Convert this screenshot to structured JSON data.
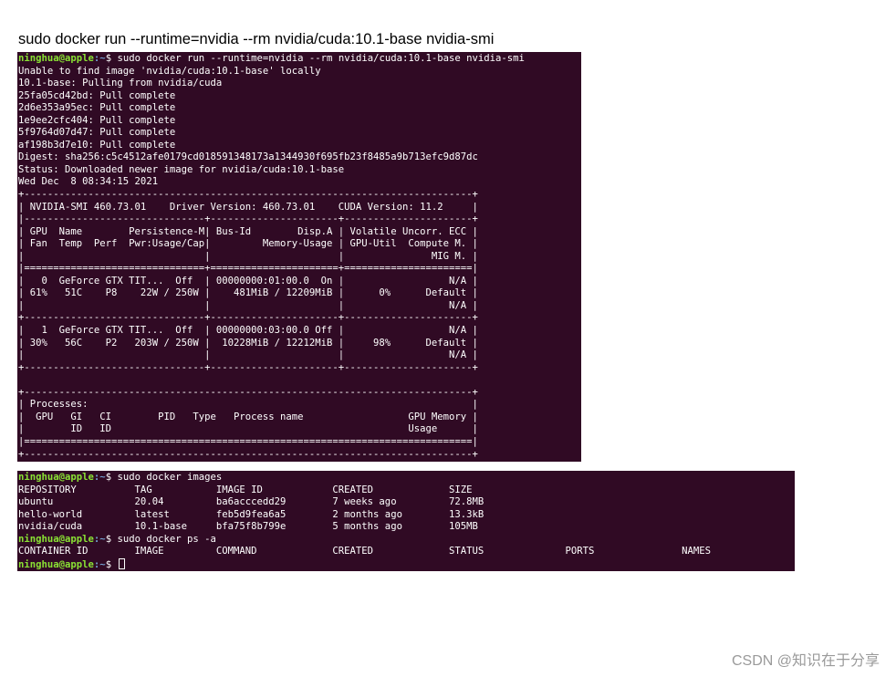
{
  "caption": "sudo docker run --runtime=nvidia --rm nvidia/cuda:10.1-base nvidia-smi",
  "prompt": {
    "user_host": "ninghua@apple",
    "path": ":~",
    "symbol": "$ "
  },
  "terminal1": {
    "command": "sudo docker run --runtime=nvidia --rm nvidia/cuda:10.1-base nvidia-smi",
    "lines": [
      "Unable to find image 'nvidia/cuda:10.1-base' locally",
      "10.1-base: Pulling from nvidia/cuda",
      "25fa05cd42bd: Pull complete",
      "2d6e353a95ec: Pull complete",
      "1e9ee2cfc404: Pull complete",
      "5f9764d07d47: Pull complete",
      "af198b3d7e10: Pull complete",
      "Digest: sha256:c5c4512afe0179cd01859134817 3a1344930f695fb23f8485a9b713efc9d87dc",
      "Status: Downloaded newer image for nvidia/cuda:10.1-base",
      "Wed Dec  8 08:34:15 2021",
      "+-----------------------------------------------------------------------------+",
      "| NVIDIA-SMI 460.73.01    Driver Version: 460.73.01    CUDA Version: 11.2     |",
      "|-------------------------------+----------------------+----------------------+",
      "| GPU  Name        Persistence-M| Bus-Id        Disp.A | Volatile Uncorr. ECC |",
      "| Fan  Temp  Perf  Pwr:Usage/Cap|         Memory-Usage | GPU-Util  Compute M. |",
      "|                               |                      |               MIG M. |",
      "|===============================+======================+======================|",
      "|   0  GeForce GTX TIT...  Off  | 00000000:01:00.0  On |                  N/A |",
      "| 61%   51C    P8    22W / 250W |    481MiB / 12209MiB |      0%      Default |",
      "|                               |                      |                  N/A |",
      "+-------------------------------+----------------------+----------------------+",
      "|   1  GeForce GTX TIT...  Off  | 00000000:03:00.0 Off |                  N/A |",
      "| 30%   56C    P2   203W / 250W |  10228MiB / 12212MiB |     98%      Default |",
      "|                               |                      |                  N/A |",
      "+-------------------------------+----------------------+----------------------+",
      "",
      "+-----------------------------------------------------------------------------+",
      "| Processes:                                                                  |",
      "|  GPU   GI   CI        PID   Type   Process name                  GPU Memory |",
      "|        ID   ID                                                   Usage      |",
      "|=============================================================================|",
      "+-----------------------------------------------------------------------------+"
    ]
  },
  "terminal2": {
    "images_command": "sudo docker images",
    "images_table": [
      "REPOSITORY          TAG           IMAGE ID            CREATED             SIZE",
      "ubuntu              20.04         ba6acccedd29        7 weeks ago         72.8MB",
      "hello-world         latest        feb5d9fea6a5        2 months ago        13.3kB",
      "nvidia/cuda         10.1-base     bfa75f8b799e        5 months ago        105MB"
    ],
    "ps_command": "sudo docker ps -a",
    "ps_header": "CONTAINER ID        IMAGE         COMMAND             CREATED             STATUS              PORTS               NAMES"
  },
  "watermark": "CSDN @知识在于分享"
}
